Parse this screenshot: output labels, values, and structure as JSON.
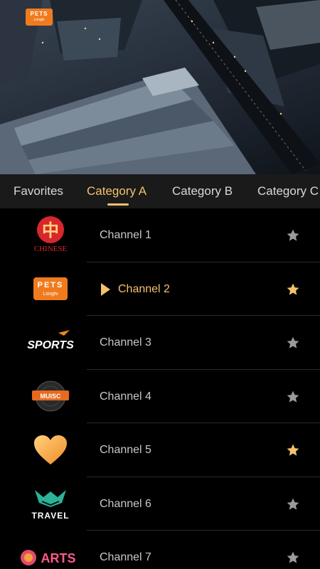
{
  "hero": {
    "logo_text": "PETS",
    "logo_sub": "Longtv"
  },
  "tabs": [
    {
      "label": "Favorites",
      "active": false
    },
    {
      "label": "Category A",
      "active": true
    },
    {
      "label": "Category B",
      "active": false
    },
    {
      "label": "Category C",
      "active": false
    }
  ],
  "channels": [
    {
      "name": "Channel 1",
      "logo": "chinese-channel-logo",
      "logo_text": "CHINESE",
      "favorite": false,
      "playing": false
    },
    {
      "name": "Channel 2",
      "logo": "pets-longtv-logo",
      "logo_text": "PETS",
      "logo_sub": "Longtv",
      "favorite": true,
      "playing": true
    },
    {
      "name": "Channel 3",
      "logo": "sports-logo",
      "logo_text": "SPORTS",
      "favorite": false,
      "playing": false
    },
    {
      "name": "Channel 4",
      "logo": "music-tv-logo",
      "logo_text": "MUISC",
      "favorite": false,
      "playing": false
    },
    {
      "name": "Channel 5",
      "logo": "heart-logo",
      "favorite": true,
      "playing": false
    },
    {
      "name": "Channel 6",
      "logo": "travel-logo",
      "logo_text": "TRAVEL",
      "favorite": false,
      "playing": false
    },
    {
      "name": "Channel 7",
      "logo": "arts-logo",
      "logo_text": "ARTS",
      "favorite": false,
      "playing": false
    }
  ],
  "colors": {
    "accent": "#f3c26b",
    "star_inactive": "#9a9a9a",
    "background": "#000000",
    "tab_bar": "#1a1a1a"
  }
}
